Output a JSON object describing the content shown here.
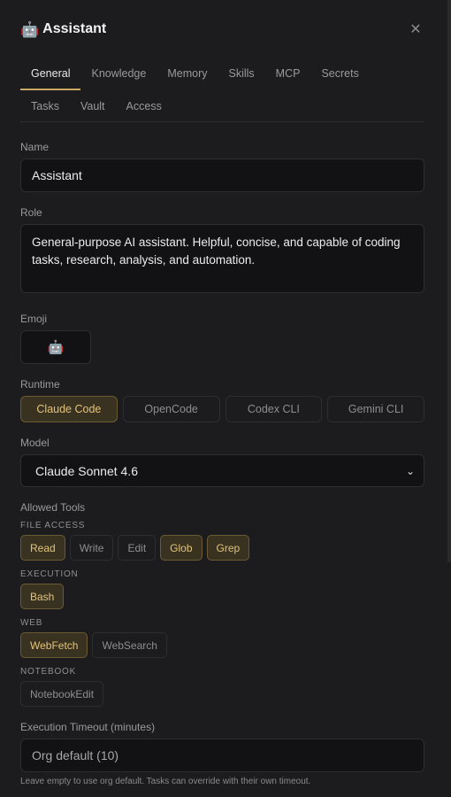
{
  "header": {
    "emoji": "🤖",
    "title": "Assistant",
    "close_glyph": "✕"
  },
  "tabs_row1": [
    "General",
    "Knowledge",
    "Memory",
    "Skills",
    "MCP",
    "Secrets"
  ],
  "tabs_row2": [
    "Tasks",
    "Vault",
    "Access"
  ],
  "active_tab": "General",
  "name": {
    "label": "Name",
    "value": "Assistant"
  },
  "role": {
    "label": "Role",
    "value": "General-purpose AI assistant. Helpful, concise, and capable of coding tasks, research, analysis, and automation."
  },
  "emoji": {
    "label": "Emoji",
    "value": "🤖"
  },
  "runtime": {
    "label": "Runtime",
    "options": [
      "Claude Code",
      "OpenCode",
      "Codex CLI",
      "Gemini CLI"
    ],
    "selected": "Claude Code"
  },
  "model": {
    "label": "Model",
    "value": "Claude Sonnet 4.6"
  },
  "tools": {
    "label": "Allowed Tools",
    "groups": {
      "file_access": {
        "label": "FILE ACCESS",
        "items": [
          "Read",
          "Write",
          "Edit",
          "Glob",
          "Grep"
        ]
      },
      "execution": {
        "label": "EXECUTION",
        "items": [
          "Bash"
        ]
      },
      "web": {
        "label": "WEB",
        "items": [
          "WebFetch",
          "WebSearch"
        ]
      },
      "notebook": {
        "label": "NOTEBOOK",
        "items": [
          "NotebookEdit"
        ]
      }
    },
    "enabled": [
      "Read",
      "Glob",
      "Grep",
      "Bash",
      "WebFetch"
    ]
  },
  "timeout": {
    "label": "Execution Timeout (minutes)",
    "placeholder": "Org default (10)",
    "help": "Leave empty to use org default. Tasks can override with their own timeout."
  },
  "colors": {
    "accent": "#c9a962",
    "background": "#1c1c1e",
    "input_bg": "#121214"
  }
}
